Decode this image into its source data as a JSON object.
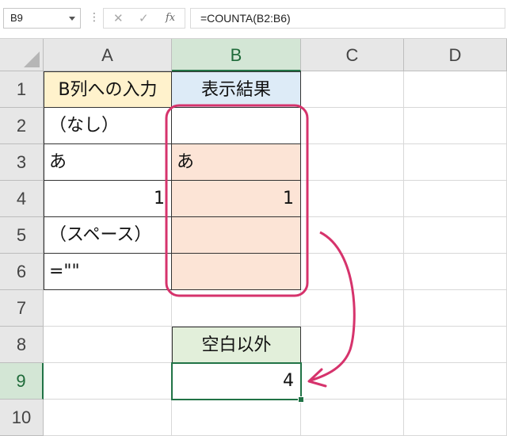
{
  "formula_bar": {
    "name_box": "B9",
    "more_icon": "⋮",
    "cancel_icon": "✕",
    "enter_icon": "✓",
    "fx_label": "fx",
    "formula": "=COUNTA(B2:B6)"
  },
  "columns": [
    "A",
    "B",
    "C",
    "D"
  ],
  "rows": [
    "1",
    "2",
    "3",
    "4",
    "5",
    "6",
    "7",
    "8",
    "9",
    "10"
  ],
  "cells": {
    "A1": "B列への入力",
    "B1": "表示結果",
    "A2": "（なし）",
    "A3": "あ",
    "B3": "あ",
    "A4": "1",
    "B4": "1",
    "A5": "（スペース）",
    "A6": "=\"\"",
    "B8": "空白以外",
    "B9": "4"
  },
  "colors": {
    "header_fill_a1": "#fff2cc",
    "header_fill_b1": "#ddebf7",
    "result_fill": "#fce4d6",
    "label_fill_b8": "#e2efda",
    "highlight_stroke": "#d6336c",
    "selection": "#217346"
  }
}
